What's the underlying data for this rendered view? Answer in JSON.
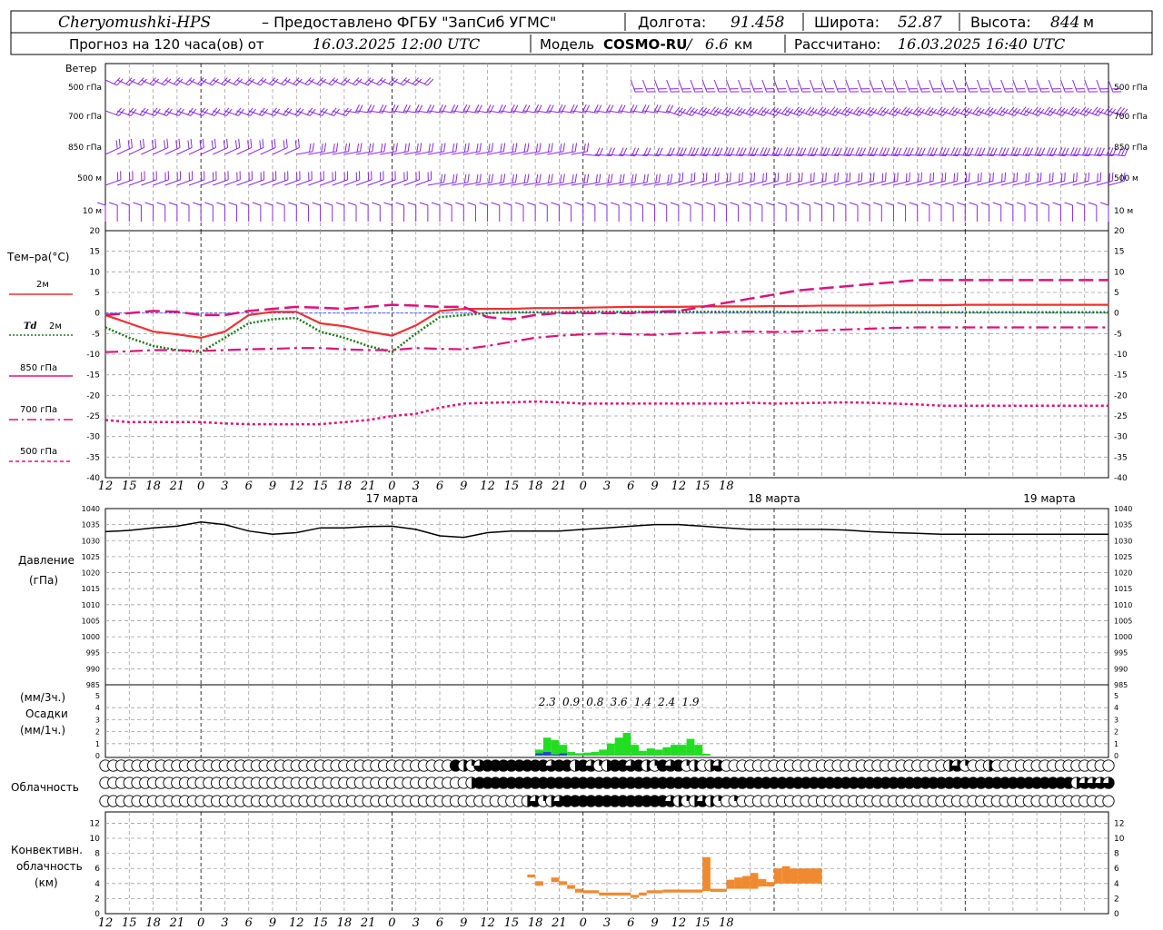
{
  "header": {
    "station": "Cheryomushki-HPS",
    "provider": "– Предоставлено ФГБУ \"ЗапСиб УГМС\"",
    "lon_label": "Долгота:",
    "lon": "91.458",
    "lat_label": "Широта:",
    "lat": "52.87",
    "alt_label": "Высота:",
    "alt": "844",
    "alt_unit": "м",
    "forecast_label": "Прогноз на 120 часа(ов) от",
    "forecast_start": "16.03.2025 12:00 UTC",
    "model_label": "Модель",
    "model_name": "COSMO-RU",
    "model_res": "6.6",
    "model_res_unit": "км",
    "computed_label": "Рассчитано:",
    "computed_time": "16.03.2025 16:40 UTC"
  },
  "labels": {
    "wind": "Ветер",
    "temp": "Тем–ра(°C)",
    "t2m": "2м",
    "td_symbol": "Td",
    "td2m": "2м",
    "p850": "850 гПа",
    "p700": "700 гПа",
    "p500": "500 гПа",
    "pressure": "Давление",
    "pressure_unit": "(гПа)",
    "precip_unit3": "(мм/3ч.)",
    "precip": "Осадки",
    "precip_unit1": "(мм/1ч.)",
    "cloud": "Облачность",
    "conv1": "Конвективн.",
    "conv2": "облачность",
    "conv3": "(км)"
  },
  "colors": {
    "wind": "#8a2be2",
    "t2m": "#f03030",
    "td2m": "#1a7a1a",
    "t850": "#e0107a",
    "t700": "#e0107a",
    "t500": "#e0107a",
    "pressure": "#000000",
    "precip_rain": "#22dd22",
    "precip_snow": "#2244cc",
    "conv": "#f08a30",
    "grid": "#a0a0a0"
  },
  "chart_data": [
    {
      "type": "wind_barbs",
      "levels": [
        "500 гПа",
        "700 гПа",
        "850 гПа",
        "500 м",
        "10  м"
      ],
      "title": "Ветер"
    },
    {
      "type": "line",
      "title": "Тем–ра(°C)",
      "x": [
        0,
        3,
        6,
        9,
        12,
        15,
        18,
        21,
        24,
        27,
        30,
        33,
        36,
        39,
        42,
        45,
        48,
        51,
        54,
        57,
        60,
        63,
        66,
        69,
        72,
        75,
        78,
        81,
        84,
        87,
        90,
        93,
        96,
        99,
        102,
        105,
        108,
        111,
        114,
        117,
        120,
        123,
        126
      ],
      "x_ticks": [
        "12",
        "15",
        "18",
        "21",
        "0",
        "3",
        "6",
        "9",
        "12",
        "15",
        "18",
        "21",
        "0",
        "3",
        "6",
        "9",
        "12",
        "15",
        "18",
        "21",
        "0",
        "3",
        "6",
        "9",
        "12",
        "15",
        "18"
      ],
      "day_labels": [
        "17 марта",
        "18 марта",
        "19 марта"
      ],
      "ylim": [
        -40,
        20
      ],
      "yticks": [
        20,
        15,
        10,
        5,
        0,
        -5,
        -10,
        -15,
        -20,
        -25,
        -30,
        -35,
        -40
      ],
      "series": [
        {
          "name": "2м",
          "values": [
            -0.5,
            -2.5,
            -4.5,
            -5.2,
            -6,
            -4.5,
            -0.5,
            0.3,
            0.3,
            -2.5,
            -3.2,
            -4.5,
            -5.5,
            -3,
            0.5,
            1,
            1,
            1,
            1.2,
            1.2,
            1.3,
            1.4,
            1.5,
            1.5,
            1.5,
            1.6,
            1.6,
            1.6,
            1.7,
            1.7,
            1.8,
            1.8,
            1.8,
            1.9,
            1.9,
            1.9,
            2,
            2,
            2,
            2,
            2,
            2,
            2
          ]
        },
        {
          "name": "Td 2м",
          "values": [
            -3.5,
            -6,
            -8,
            -9,
            -9.5,
            -6,
            -2.5,
            -1.5,
            -1.2,
            -4.5,
            -6,
            -8,
            -9.5,
            -5,
            -1,
            -0.5,
            0,
            0.2,
            0.2,
            0.2,
            0.3,
            0.3,
            0.3,
            0.3,
            0.3,
            0.3,
            0.3,
            0.3,
            0.3,
            0.2,
            0.2,
            0.2,
            0.2,
            0.2,
            0.2,
            0.2,
            0.2,
            0.2,
            0.2,
            0.2,
            0.2,
            0.2,
            0.2
          ]
        },
        {
          "name": "850 гПа",
          "values": [
            -0.5,
            0,
            0.5,
            0.3,
            -0.5,
            -0.5,
            0.5,
            1,
            1.5,
            1.3,
            1,
            1.5,
            2,
            1.8,
            1.5,
            1.5,
            -1,
            -1.5,
            -0.5,
            0,
            0,
            0,
            0,
            0.3,
            0.5,
            1.5,
            2.5,
            3.5,
            4.5,
            5.5,
            6,
            6.5,
            7,
            7.5,
            8,
            8,
            8,
            8,
            8,
            8,
            8,
            8,
            8
          ]
        },
        {
          "name": "700 гПа",
          "values": [
            -9.5,
            -9.3,
            -9,
            -9,
            -9.2,
            -9,
            -8.8,
            -8.7,
            -8.5,
            -8.5,
            -8.8,
            -9,
            -9,
            -8.5,
            -8.7,
            -8.8,
            -8,
            -7,
            -6,
            -5.5,
            -5.2,
            -5,
            -5.2,
            -5.3,
            -5,
            -4.8,
            -4.6,
            -4.5,
            -4.6,
            -4.5,
            -4.2,
            -4,
            -3.8,
            -3.6,
            -3.5,
            -3.5,
            -3.5,
            -3.5,
            -3.5,
            -3.5,
            -3.5,
            -3.5,
            -3.5
          ]
        },
        {
          "name": "500 гПа",
          "values": [
            -26,
            -26.5,
            -26.5,
            -26.5,
            -26.5,
            -26.8,
            -27,
            -27,
            -27,
            -27,
            -26.5,
            -26,
            -25,
            -24.5,
            -23,
            -22,
            -21.8,
            -21.7,
            -21.5,
            -21.7,
            -22,
            -22,
            -22,
            -22,
            -22,
            -22,
            -22,
            -21.8,
            -22,
            -21.9,
            -21.8,
            -21.7,
            -21.8,
            -22,
            -22.2,
            -22.5,
            -22.5,
            -22.5,
            -22.5,
            -22.5,
            -22.5,
            -22.5,
            -22.5
          ]
        }
      ]
    },
    {
      "type": "line",
      "title": "Давление",
      "ylabel": "(гПа)",
      "ylim": [
        985,
        1040
      ],
      "yticks": [
        1040,
        1035,
        1030,
        1025,
        1020,
        1015,
        1010,
        1005,
        1000,
        995,
        990,
        985
      ],
      "series": [
        {
          "name": "Давление",
          "values": [
            1032.8,
            1033.2,
            1034,
            1034.5,
            1035.8,
            1035,
            1033,
            1032,
            1032.5,
            1034,
            1034,
            1034.4,
            1034.5,
            1033.5,
            1031.5,
            1031,
            1032.5,
            1033,
            1033,
            1033,
            1033.5,
            1034,
            1034.5,
            1035,
            1035,
            1034.5,
            1034,
            1033.5,
            1033.5,
            1033.5,
            1033.5,
            1033.3,
            1032.8,
            1032.5,
            1032.3,
            1032,
            1032,
            1032,
            1032,
            1032,
            1032,
            1032,
            1032
          ]
        }
      ]
    },
    {
      "type": "bar",
      "title": "Осадки",
      "ylabel": "(мм/1ч.)",
      "ylim": [
        0,
        5
      ],
      "yticks": [
        5,
        4,
        3,
        2,
        1,
        0
      ],
      "sums_3h": [
        "2.3",
        "0.9",
        "0.8",
        "3.6",
        "1.4",
        "2.4",
        "1.9"
      ],
      "bars": [
        {
          "h": 54,
          "rain": 0.3,
          "snow": 0.2
        },
        {
          "h": 55,
          "rain": 1.2,
          "snow": 0.3
        },
        {
          "h": 56,
          "rain": 1.2,
          "snow": 0.1
        },
        {
          "h": 57,
          "rain": 0.7,
          "snow": 0.2
        },
        {
          "h": 58,
          "rain": 0.3,
          "snow": 0
        },
        {
          "h": 59,
          "rain": 0.2,
          "snow": 0
        },
        {
          "h": 60,
          "rain": 0.25,
          "snow": 0
        },
        {
          "h": 61,
          "rain": 0.3,
          "snow": 0
        },
        {
          "h": 62,
          "rain": 0.5,
          "snow": 0
        },
        {
          "h": 63,
          "rain": 1.0,
          "snow": 0
        },
        {
          "h": 64,
          "rain": 1.5,
          "snow": 0
        },
        {
          "h": 65,
          "rain": 1.9,
          "snow": 0
        },
        {
          "h": 66,
          "rain": 0.9,
          "snow": 0
        },
        {
          "h": 67,
          "rain": 0.4,
          "snow": 0
        },
        {
          "h": 68,
          "rain": 0.6,
          "snow": 0
        },
        {
          "h": 69,
          "rain": 0.5,
          "snow": 0
        },
        {
          "h": 70,
          "rain": 0.7,
          "snow": 0
        },
        {
          "h": 71,
          "rain": 0.9,
          "snow": 0
        },
        {
          "h": 72,
          "rain": 0.9,
          "snow": 0
        },
        {
          "h": 73,
          "rain": 1.4,
          "snow": 0
        },
        {
          "h": 74,
          "rain": 0.9,
          "snow": 0
        },
        {
          "h": 75,
          "rain": 0.15,
          "snow": 0
        }
      ]
    },
    {
      "type": "cloud_cover",
      "title": "Облачность",
      "rows": [
        {
          "level": "high",
          "cover_by_hour": [
            0,
            0,
            0,
            0,
            0,
            0,
            0,
            0,
            0,
            0,
            0,
            0,
            0,
            0,
            0,
            0,
            0,
            0,
            0,
            0,
            0,
            0,
            0,
            0,
            0,
            0,
            0,
            0,
            0,
            0,
            0,
            0,
            0,
            0,
            0,
            0,
            0,
            0,
            0,
            0,
            0,
            0,
            0,
            0,
            0,
            0,
            0,
            0,
            0,
            0,
            0,
            0,
            0,
            0,
            0,
            0,
            0,
            0,
            0,
            0,
            0,
            0,
            0,
            0,
            0,
            0,
            0,
            0,
            0,
            0,
            0,
            0,
            0,
            0,
            0,
            0,
            0,
            0,
            0,
            0,
            0,
            0,
            0,
            0,
            0,
            0,
            0,
            0,
            0,
            0,
            0,
            0,
            0,
            0,
            0,
            0,
            0,
            0,
            0,
            0,
            0,
            0,
            0,
            0,
            0,
            0,
            0,
            0,
            0,
            0,
            0,
            0,
            0,
            0,
            0,
            0,
            0,
            0,
            0,
            0,
            0,
            0,
            0
          ]
        },
        {
          "level": "mid",
          "cover_by_hour": []
        },
        {
          "level": "low",
          "cover_by_hour": []
        }
      ]
    },
    {
      "type": "bar",
      "title": "Конвективн. облачность (км)",
      "ylim": [
        0,
        13
      ],
      "yticks": [
        12,
        10,
        8,
        6,
        4,
        2,
        0
      ],
      "segments": [
        {
          "h0": 53,
          "h1": 54,
          "top": 5.2,
          "base": 4.8
        },
        {
          "h0": 54,
          "h1": 55,
          "top": 4.3,
          "base": 3.7
        },
        {
          "h0": 56,
          "h1": 57,
          "top": 4.8,
          "base": 4.2
        },
        {
          "h0": 57,
          "h1": 58,
          "top": 4.3,
          "base": 3.8
        },
        {
          "h0": 58,
          "h1": 59,
          "top": 3.8,
          "base": 3.3
        },
        {
          "h0": 59,
          "h1": 60,
          "top": 3.3,
          "base": 2.8
        },
        {
          "h0": 60,
          "h1": 62,
          "top": 3.1,
          "base": 2.7
        },
        {
          "h0": 62,
          "h1": 66,
          "top": 2.8,
          "base": 2.4
        },
        {
          "h0": 66,
          "h1": 67,
          "top": 2.5,
          "base": 2.1
        },
        {
          "h0": 67,
          "h1": 68,
          "top": 2.8,
          "base": 2.4
        },
        {
          "h0": 68,
          "h1": 70,
          "top": 3.1,
          "base": 2.7
        },
        {
          "h0": 70,
          "h1": 75,
          "top": 3.2,
          "base": 2.8
        },
        {
          "h0": 75,
          "h1": 76,
          "top": 7.5,
          "base": 3.0
        },
        {
          "h0": 76,
          "h1": 78,
          "top": 3.3,
          "base": 2.9
        },
        {
          "h0": 78,
          "h1": 79,
          "top": 4.5,
          "base": 3.3
        },
        {
          "h0": 79,
          "h1": 80,
          "top": 4.8,
          "base": 3.3
        },
        {
          "h0": 80,
          "h1": 81,
          "top": 5.0,
          "base": 3.3
        },
        {
          "h0": 81,
          "h1": 82,
          "top": 5.4,
          "base": 3.3
        },
        {
          "h0": 82,
          "h1": 83,
          "top": 4.6,
          "base": 3.6
        },
        {
          "h0": 83,
          "h1": 84,
          "top": 4.2,
          "base": 3.6
        },
        {
          "h0": 84,
          "h1": 85,
          "top": 6.0,
          "base": 4.0
        },
        {
          "h0": 85,
          "h1": 86,
          "top": 6.3,
          "base": 4.0
        },
        {
          "h0": 86,
          "h1": 87,
          "top": 6.0,
          "base": 4.0
        },
        {
          "h0": 87,
          "h1": 90,
          "top": 6.0,
          "base": 4.0
        }
      ]
    }
  ]
}
